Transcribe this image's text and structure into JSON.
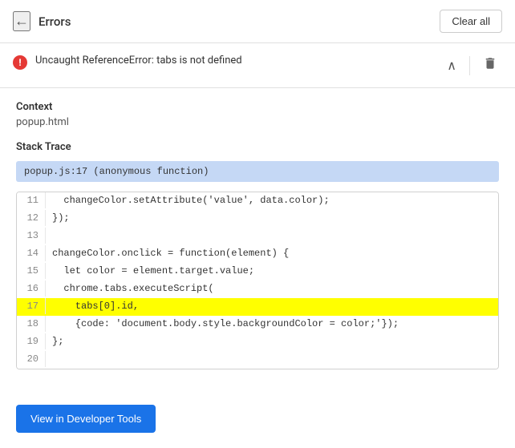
{
  "header": {
    "back_label": "←",
    "title": "Errors",
    "clear_all_label": "Clear all"
  },
  "error": {
    "message": "Uncaught ReferenceError: tabs is not defined",
    "icon_label": "!"
  },
  "context": {
    "section_title": "Context",
    "value": "popup.html"
  },
  "stack_trace": {
    "section_title": "Stack Trace",
    "trace_text": "popup.js:17 (anonymous function)"
  },
  "code": {
    "lines": [
      {
        "num": "11",
        "text": "  changeColor.setAttribute('value', data.color);",
        "highlight": false
      },
      {
        "num": "12",
        "text": "});",
        "highlight": false
      },
      {
        "num": "13",
        "text": "",
        "highlight": false
      },
      {
        "num": "14",
        "text": "changeColor.onclick = function(element) {",
        "highlight": false
      },
      {
        "num": "15",
        "text": "  let color = element.target.value;",
        "highlight": false
      },
      {
        "num": "16",
        "text": "  chrome.tabs.executeScript(",
        "highlight": false
      },
      {
        "num": "17",
        "text": "    tabs[0].id,",
        "highlight": true
      },
      {
        "num": "18",
        "text": "    {code: 'document.body.style.backgroundColor = color;'});",
        "highlight": false
      },
      {
        "num": "19",
        "text": "};",
        "highlight": false
      },
      {
        "num": "20",
        "text": "",
        "highlight": false
      }
    ]
  },
  "footer": {
    "dev_tools_label": "View in Developer Tools"
  }
}
